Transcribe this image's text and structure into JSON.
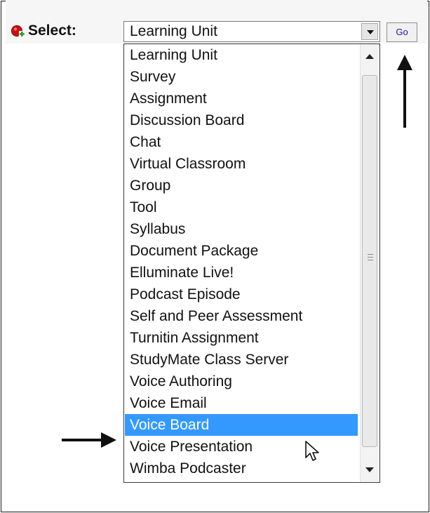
{
  "toolbar": {
    "add_icon": "add-plus-icon",
    "select_label": "Select:",
    "combo_value": "Learning Unit",
    "go_label": "Go"
  },
  "dropdown": {
    "items": [
      {
        "label": "Learning Unit"
      },
      {
        "label": "Survey"
      },
      {
        "label": "Assignment"
      },
      {
        "label": "Discussion Board"
      },
      {
        "label": "Chat"
      },
      {
        "label": "Virtual Classroom"
      },
      {
        "label": "Group"
      },
      {
        "label": "Tool"
      },
      {
        "label": "Syllabus"
      },
      {
        "label": "Document Package"
      },
      {
        "label": "Elluminate Live!"
      },
      {
        "label": "Podcast Episode"
      },
      {
        "label": "Self and Peer Assessment"
      },
      {
        "label": "Turnitin Assignment"
      },
      {
        "label": "StudyMate Class Server"
      },
      {
        "label": "Voice Authoring"
      },
      {
        "label": "Voice Email"
      },
      {
        "label": "Voice Board"
      },
      {
        "label": "Voice Presentation"
      },
      {
        "label": "Wimba Podcaster"
      }
    ],
    "highlighted": "Voice Board"
  },
  "colors": {
    "highlight": "#3399ff",
    "go_text": "#1a1a9a",
    "icon_red": "#cc1111",
    "icon_green": "#2a9a2a"
  }
}
